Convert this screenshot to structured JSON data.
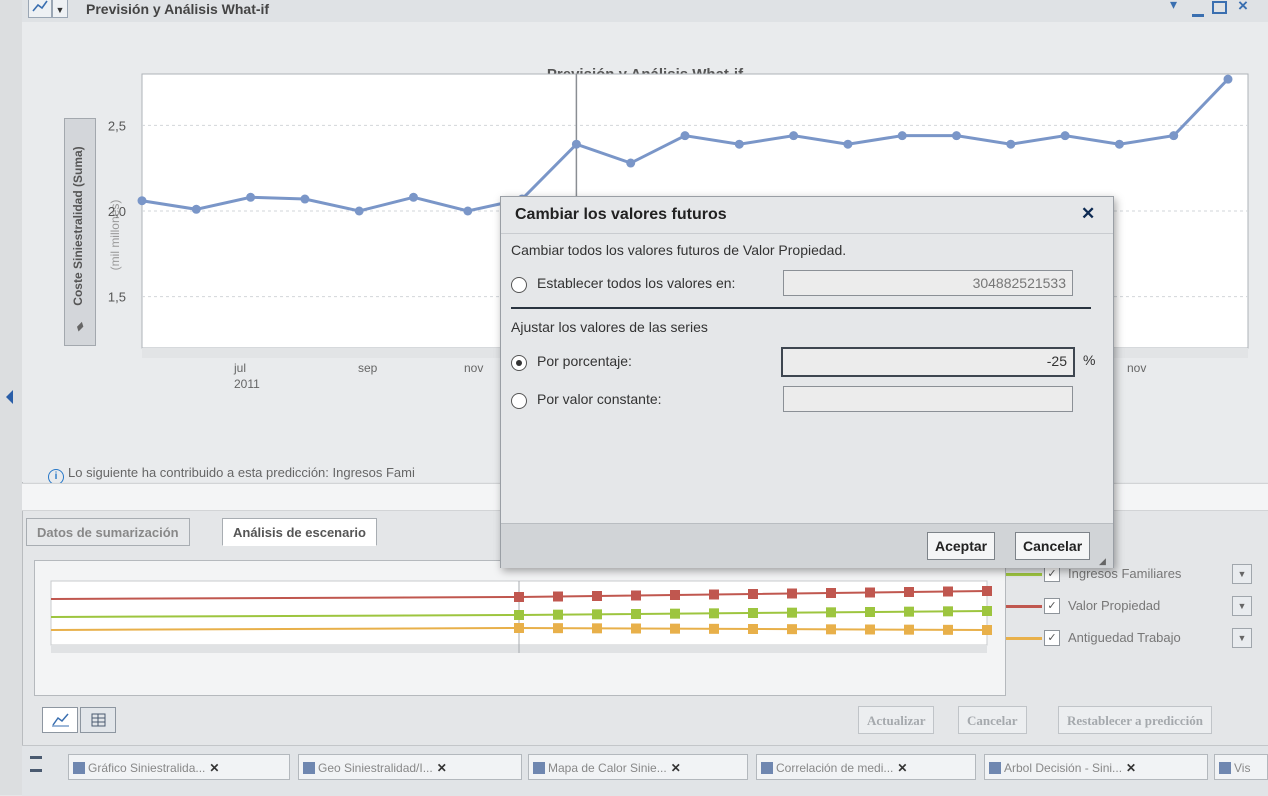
{
  "window": {
    "title": "Previsión y Análisis What-if"
  },
  "chart_data": {
    "type": "line",
    "title": "Previsión y Análisis What-if",
    "ylabel": "Coste Siniestralidad (Suma)",
    "ylabel_unit": "(mil millones)",
    "ylim": [
      1.2,
      2.8
    ],
    "yticks": [
      "2,5",
      "2,0",
      "1,5"
    ],
    "xticks": [
      "jul",
      "2011",
      "sep",
      "nov",
      "nov"
    ],
    "forecast_start_index": 10,
    "values": [
      2.06,
      2.01,
      2.08,
      2.07,
      2.0,
      2.08,
      2.0,
      2.07,
      2.39,
      2.28,
      2.44,
      2.39,
      2.44,
      2.39,
      2.44,
      2.44,
      2.39,
      2.44,
      2.39,
      2.44,
      2.77
    ],
    "grid": true
  },
  "info_text": "Lo siguiente ha contribuido a esta predicción: Ingresos Fami",
  "tabs": [
    "Datos de sumarización",
    "Análisis de escenario"
  ],
  "legend": [
    {
      "label": "Ingresos Familiares",
      "color": "#9dc53f",
      "checked": true
    },
    {
      "label": "Valor Propiedad",
      "color": "#c0574f",
      "checked": true
    },
    {
      "label": "Antiguedad Trabajo",
      "color": "#e8b04a",
      "checked": true
    }
  ],
  "actions": {
    "update": "Actualizar",
    "cancel": "Cancelar",
    "reset": "Restablecer a predicción"
  },
  "taskbar": [
    "Gráfico Siniestralida...",
    "Geo Siniestralidad/I...",
    "Mapa de Calor Sinie...",
    "Correlación de medi...",
    "Arbol Decisión - Sini...",
    "Vis"
  ],
  "dialog": {
    "title": "Cambiar los valores futuros",
    "intro": "Cambiar todos los valores futuros de Valor Propiedad.",
    "set_all_label": "Establecer todos los valores en:",
    "set_all_value": "304882521533",
    "adjust_label": "Ajustar los valores de las series",
    "percent_label": "Por porcentaje:",
    "percent_value": "-25",
    "percent_unit": "%",
    "constant_label": "Por valor constante:",
    "constant_value": "",
    "selected": "percent",
    "ok": "Aceptar",
    "cancel": "Cancelar"
  }
}
